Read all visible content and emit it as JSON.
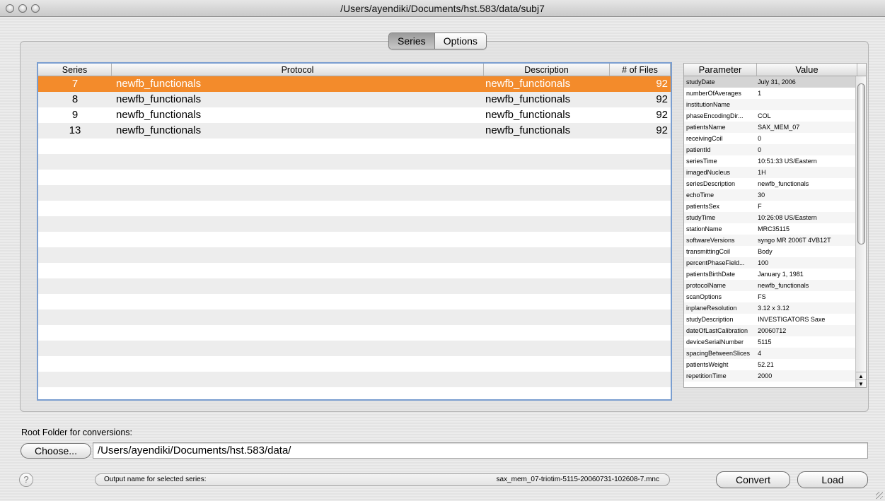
{
  "window": {
    "title": "/Users/ayendiki/Documents/hst.583/data/subj7"
  },
  "tabs": [
    {
      "label": "Series",
      "active": true
    },
    {
      "label": "Options",
      "active": false
    }
  ],
  "series_table": {
    "columns": [
      "Series",
      "Protocol",
      "Description",
      "# of Files"
    ],
    "rows": [
      {
        "series": "7",
        "protocol": "newfb_functionals",
        "description": "newfb_functionals",
        "files": "92",
        "selected": true
      },
      {
        "series": "8",
        "protocol": "newfb_functionals",
        "description": "newfb_functionals",
        "files": "92",
        "selected": false
      },
      {
        "series": "9",
        "protocol": "newfb_functionals",
        "description": "newfb_functionals",
        "files": "92",
        "selected": false
      },
      {
        "series": "13",
        "protocol": "newfb_functionals",
        "description": "newfb_functionals",
        "files": "92",
        "selected": false
      }
    ],
    "selection_color": "#f38b2b"
  },
  "param_table": {
    "columns": [
      "Parameter",
      "Value"
    ],
    "rows": [
      {
        "name": "studyDate",
        "value": "July 31, 2006"
      },
      {
        "name": "numberOfAverages",
        "value": "1"
      },
      {
        "name": "institutionName",
        "value": ""
      },
      {
        "name": "phaseEncodingDir...",
        "value": "COL"
      },
      {
        "name": "patientsName",
        "value": "SAX_MEM_07"
      },
      {
        "name": "receivingCoil",
        "value": "0"
      },
      {
        "name": "patientId",
        "value": "0"
      },
      {
        "name": "seriesTime",
        "value": "10:51:33 US/Eastern"
      },
      {
        "name": "imagedNucleus",
        "value": "1H"
      },
      {
        "name": "seriesDescription",
        "value": "newfb_functionals"
      },
      {
        "name": "echoTime",
        "value": "30"
      },
      {
        "name": "patientsSex",
        "value": "F"
      },
      {
        "name": "studyTime",
        "value": "10:26:08 US/Eastern"
      },
      {
        "name": "stationName",
        "value": "MRC35115"
      },
      {
        "name": "softwareVersions",
        "value": "syngo MR 2006T 4VB12T"
      },
      {
        "name": "transmittingCoil",
        "value": "Body"
      },
      {
        "name": "percentPhaseField...",
        "value": "100"
      },
      {
        "name": "patientsBirthDate",
        "value": "January 1, 1981"
      },
      {
        "name": "protocolName",
        "value": "newfb_functionals"
      },
      {
        "name": "scanOptions",
        "value": "FS"
      },
      {
        "name": "inplaneResolution",
        "value": "3.12 x 3.12"
      },
      {
        "name": "studyDescription",
        "value": "INVESTIGATORS Saxe"
      },
      {
        "name": "dateOfLastCalibration",
        "value": "20060712"
      },
      {
        "name": "deviceSerialNumber",
        "value": "5115"
      },
      {
        "name": "spacingBetweenSlices",
        "value": "4"
      },
      {
        "name": "patientsWeight",
        "value": "52.21"
      },
      {
        "name": "repetitionTime",
        "value": "2000"
      }
    ]
  },
  "root_folder": {
    "label": "Root Folder for conversions:",
    "choose_label": "Choose...",
    "path": "/Users/ayendiki/Documents/hst.583/data/"
  },
  "output": {
    "label": "Output name for selected series:",
    "value": "sax_mem_07-triotim-5115-20060731-102608-7.mnc"
  },
  "buttons": {
    "help": "?",
    "convert": "Convert",
    "load": "Load"
  }
}
